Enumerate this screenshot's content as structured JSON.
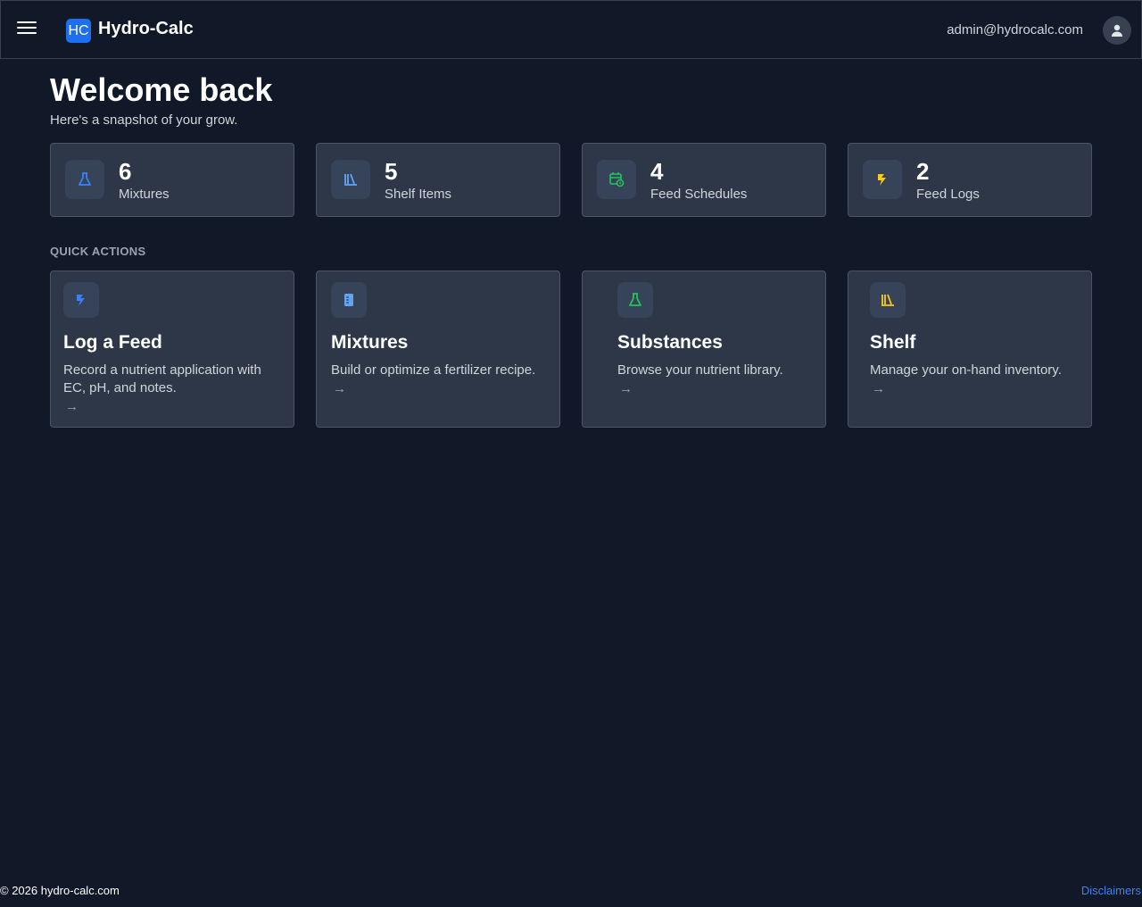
{
  "header": {
    "logo_text": "HC",
    "app_title": "Hydro-Calc",
    "user_email": "admin@hydrocalc.com"
  },
  "welcome": {
    "title": "Welcome back",
    "subtitle": "Here's a snapshot of your grow."
  },
  "stats": [
    {
      "value": "6",
      "label": "Mixtures",
      "icon": "flask-icon",
      "color": "#3b82f6"
    },
    {
      "value": "5",
      "label": "Shelf Items",
      "icon": "shelf-icon",
      "color": "#60a5fa"
    },
    {
      "value": "4",
      "label": "Feed Schedules",
      "icon": "calendar-clock-icon",
      "color": "#22c55e"
    },
    {
      "value": "2",
      "label": "Feed Logs",
      "icon": "feed-log-icon",
      "color": "#facc15"
    }
  ],
  "quick_actions": {
    "section_label": "QUICK ACTIONS",
    "items": [
      {
        "title": "Log a Feed",
        "description": "Record a nutrient application with EC, pH, and notes.",
        "arrow": "→",
        "icon": "feed-log-icon",
        "color": "#3b82f6"
      },
      {
        "title": "Mixtures",
        "description": "Build or optimize a fertilizer recipe.",
        "arrow": "→",
        "icon": "beaker-icon",
        "color": "#60a5fa"
      },
      {
        "title": "Substances",
        "description": "Browse your nutrient library.",
        "arrow": "→",
        "icon": "flask-icon",
        "color": "#22c55e"
      },
      {
        "title": "Shelf",
        "description": "Manage your on-hand inventory.",
        "arrow": "→",
        "icon": "shelf-icon",
        "color": "#facc15"
      }
    ]
  },
  "footer": {
    "copyright": "© 2026 hydro-calc.com",
    "disclaimers": "Disclaimers"
  }
}
